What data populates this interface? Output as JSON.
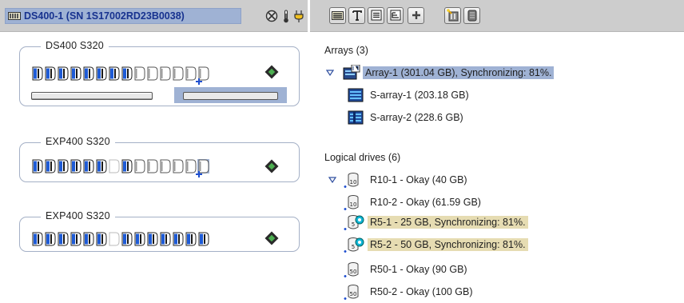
{
  "header": {
    "title": "DS400-1 (SN 1S17002RD23B0038)",
    "status_icons": [
      "event-status-icon",
      "temperature-icon",
      "power-icon"
    ],
    "toolbar_icons": [
      "show-enclosure-icon",
      "show-text-icon",
      "show-list-icon",
      "show-tree-icon",
      "add-icon",
      "hot-spare-wizard-icon",
      "storage-disk-icon"
    ]
  },
  "enclosures": [
    {
      "label": "DS400   S320",
      "slots": 14,
      "empty_slots": [
        8,
        9,
        10,
        11,
        12,
        13
      ],
      "has_hotspare_marker": true
    },
    {
      "label": "EXP400   S320",
      "slots": 14,
      "empty_slots": [
        6,
        8,
        9,
        10,
        11,
        12,
        13
      ],
      "has_hotspare_marker": true
    },
    {
      "label": "EXP400   S320",
      "slots": 14,
      "empty_slots": [
        6
      ],
      "has_hotspare_marker": false
    }
  ],
  "arrays": {
    "heading": "Arrays (3)",
    "items": [
      {
        "label": "Array-1 (301.04 GB), Synchronizing: 81%.",
        "selected": true
      },
      {
        "label": "S-array-1 (203.18 GB)",
        "selected": false
      },
      {
        "label": "S-array-2 (228.6 GB)",
        "selected": false
      }
    ]
  },
  "logical_drives": {
    "heading": "Logical drives (6)",
    "items": [
      {
        "label": "R10-1 - Okay (40 GB)",
        "raid": "10",
        "sync": false
      },
      {
        "label": "R10-2 - Okay (61.59 GB)",
        "raid": "10",
        "sync": false
      },
      {
        "label": "R5-1 - 25 GB, Synchronizing: 81%.",
        "raid": "5",
        "sync": true
      },
      {
        "label": "R5-2 - 50 GB, Synchronizing: 81%.",
        "raid": "5",
        "sync": true
      },
      {
        "label": "R50-1 - Okay (90 GB)",
        "raid": "50",
        "sync": false
      },
      {
        "label": "R50-2 - Okay (100 GB)",
        "raid": "50",
        "sync": false
      }
    ]
  },
  "colors": {
    "header_bg": "#cdcdcd",
    "selection_blue": "#9fb2d4",
    "selection_tan": "#e6dcb2",
    "title_text": "#17328f",
    "drive_blue": "#1e5bd6",
    "box_border": "#a4b0c6"
  }
}
